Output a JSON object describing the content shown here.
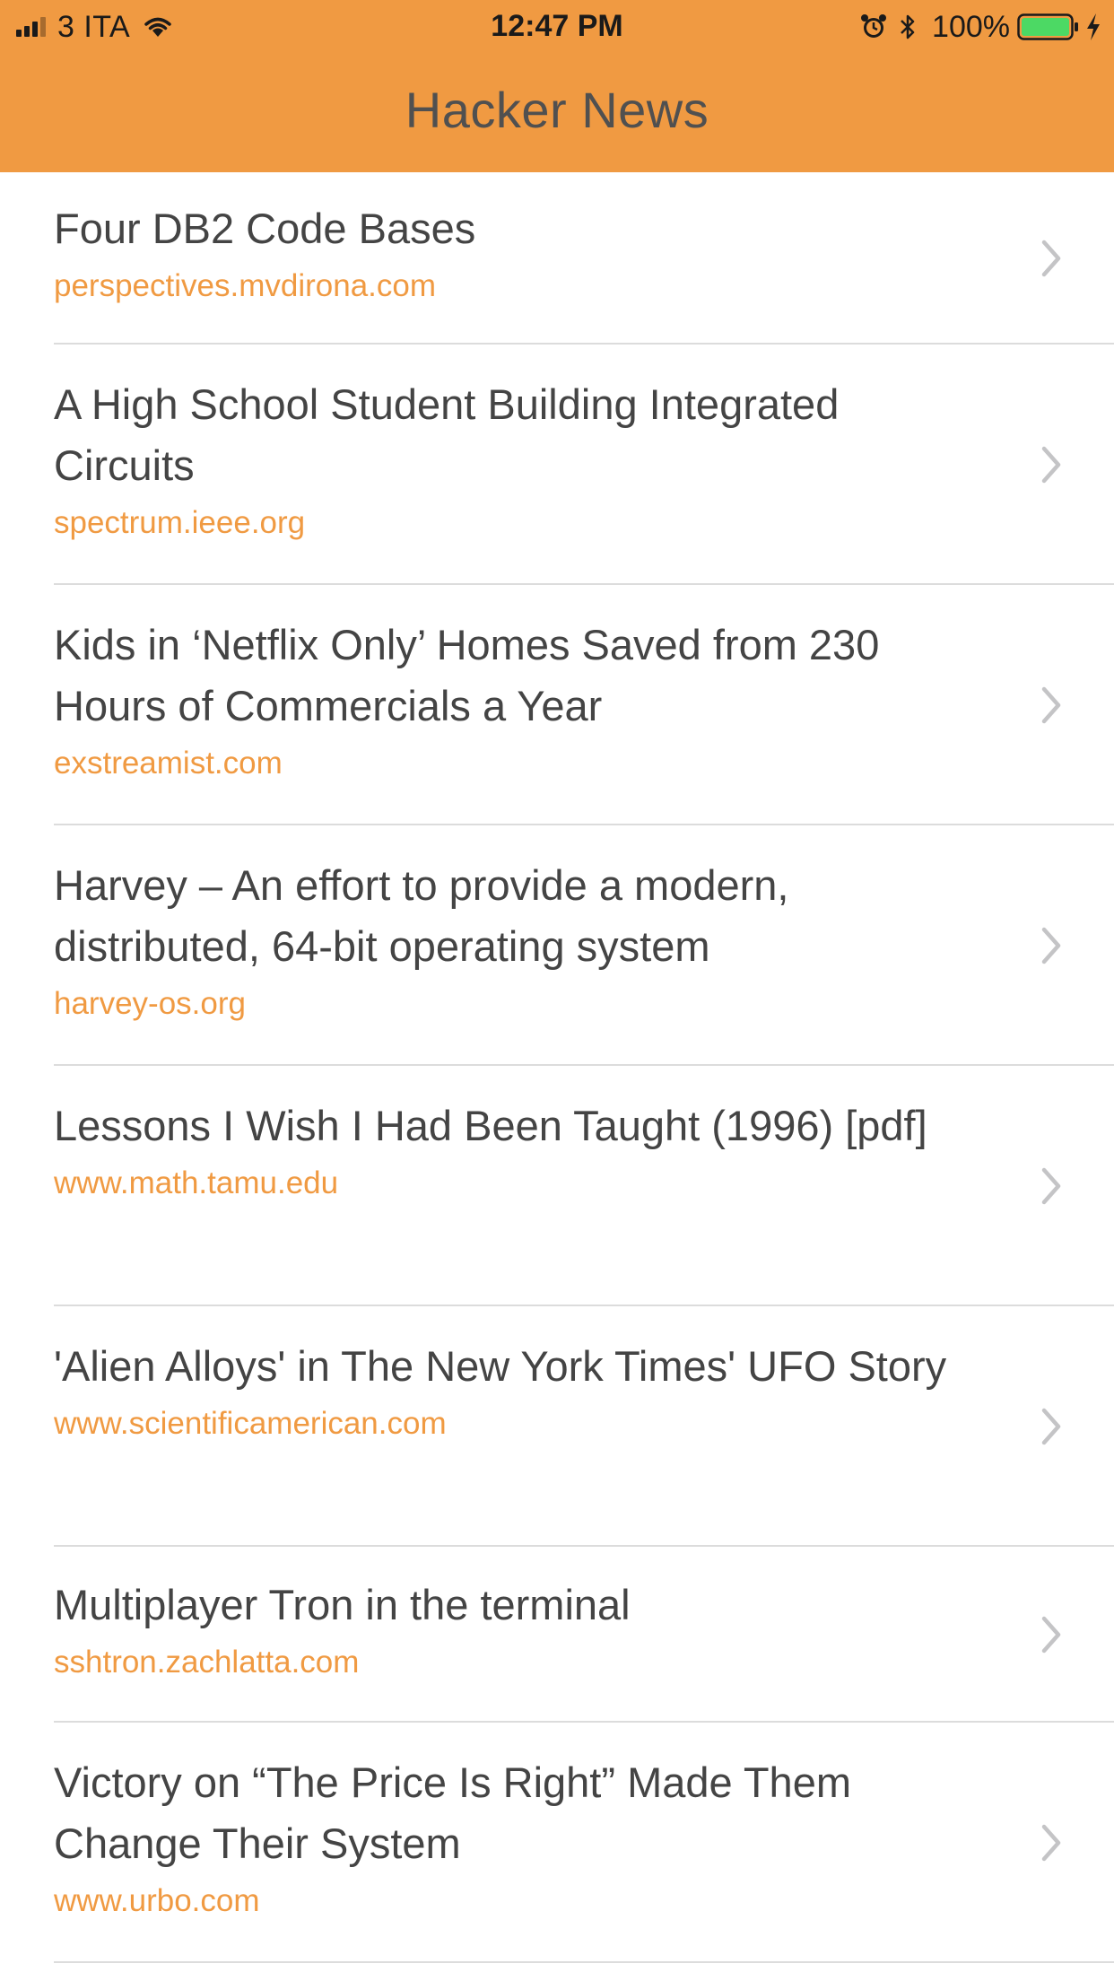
{
  "status_bar": {
    "carrier": "3 ITA",
    "time": "12:47 PM",
    "battery_percent": "100%",
    "battery_level": 1.0,
    "battery_color": "#4CD964",
    "signal_bars_active": 3,
    "signal_bars_total": 4
  },
  "header": {
    "title": "Hacker News",
    "background_color": "#F09A42"
  },
  "stories": [
    {
      "title": "Four DB2 Code Bases",
      "domain": "perspectives.mvdirona.com"
    },
    {
      "title": "A High School Student Building Integrated Circuits",
      "domain": "spectrum.ieee.org"
    },
    {
      "title": "Kids in ‘Netflix Only’ Homes Saved from 230 Hours of Commercials a Year",
      "domain": "exstreamist.com"
    },
    {
      "title": "Harvey – An effort to provide a modern, distributed, 64-bit operating system",
      "domain": "harvey-os.org"
    },
    {
      "title": "Lessons I Wish I Had Been Taught (1996) [pdf]",
      "domain": "www.math.tamu.edu"
    },
    {
      "title": "'Alien Alloys' in The New York Times' UFO Story",
      "domain": "www.scientificamerican.com"
    },
    {
      "title": "Multiplayer Tron in the terminal",
      "domain": "sshtron.zachlatta.com"
    },
    {
      "title": "Victory on “The Price Is Right” Made Them Change Their System",
      "domain": "www.urbo.com"
    }
  ],
  "icons": {
    "row_accessory": "chevron-right-icon",
    "wifi": "wifi-icon",
    "alarm": "alarm-icon",
    "bluetooth": "bluetooth-icon",
    "battery": "battery-icon",
    "charging": "charging-bolt-icon"
  }
}
